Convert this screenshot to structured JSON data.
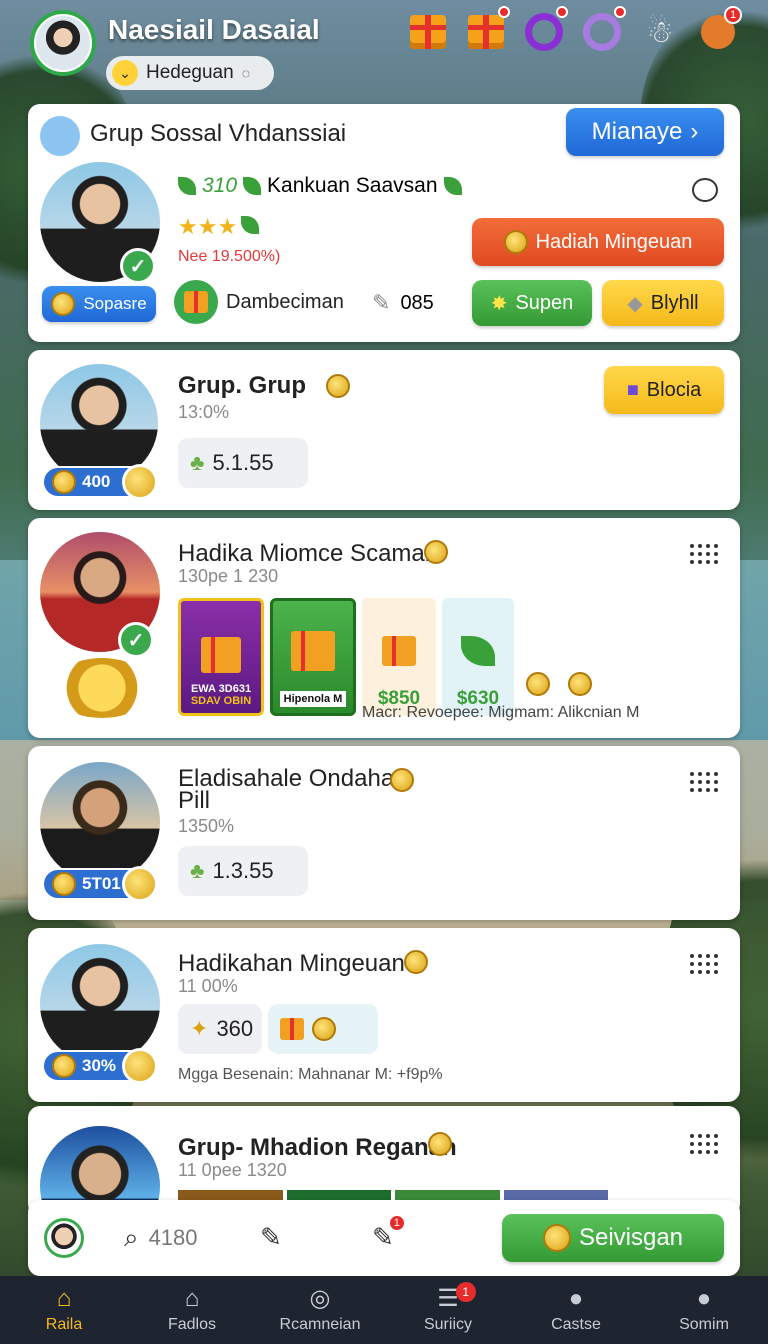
{
  "header": {
    "username": "Naesiail Dasaial",
    "status_label": "Hedeguan",
    "icons": [
      {
        "name": "gift-icon"
      },
      {
        "name": "gift-icon",
        "badge": ""
      },
      {
        "name": "ring-icon",
        "badge": ""
      },
      {
        "name": "ring-icon",
        "badge": ""
      },
      {
        "name": "mascot-icon",
        "badge": ""
      },
      {
        "name": "monkey-icon",
        "badge": "1"
      }
    ]
  },
  "featured": {
    "title": "Grup Sossal Vhdanssiai",
    "manage_label": "Mianaye",
    "rating_value": "310",
    "name": "Kankuan Saavsan",
    "stars_note": "Nee 19.500%)",
    "tag_label": "Sopasre",
    "action_label": "Dambeciman",
    "count_value": "085",
    "btn_primary": "Hadiah Mingeuan",
    "btn_support": "Supen",
    "btn_buy": "Blyhll"
  },
  "groups": [
    {
      "title": "Grup. Grup",
      "sub": "13:0%",
      "coins": "400",
      "stat": "5.1.55",
      "action": "Blocia"
    },
    {
      "title": "Hadika Miomce Scaman",
      "sub": "130pe 1 230",
      "tiles": [
        {
          "label": "SDAV OBIN",
          "sub": "EWA 3D631"
        },
        {
          "label": "Hipenola M"
        },
        {
          "price": "$850"
        },
        {
          "price": "$630"
        }
      ],
      "meta": "Macr: Revoepee: Migmam: Alikcnian M"
    },
    {
      "title": "Eladisahale Ondaha Pill",
      "sub": "1350%",
      "coins": "5T01",
      "stat": "1.3.55"
    },
    {
      "title": "Hadikahan Mingeuan",
      "sub": "11 00%",
      "coins": "30%",
      "stat": "360",
      "meta": "Mgga Besenain: Mahnanar M: +f9p%"
    },
    {
      "title": "Grup- Mhadion Reganan",
      "sub": "11 0pee 1320"
    }
  ],
  "action_bar": {
    "search_value": "4180",
    "cta_label": "Seivisgan",
    "badge": "1"
  },
  "nav": [
    {
      "label": "Raila",
      "icon": "home-icon",
      "active": true
    },
    {
      "label": "Fadlos",
      "icon": "house-outline-icon"
    },
    {
      "label": "Rcamneian",
      "icon": "target-icon"
    },
    {
      "label": "Suriicy",
      "icon": "list-icon",
      "badge": "1"
    },
    {
      "label": "Castse",
      "icon": "user-icon"
    },
    {
      "label": "Somim",
      "icon": "user-icon"
    }
  ],
  "colors": {
    "accent_green": "#3aa84c",
    "accent_blue": "#2068d6",
    "accent_orange": "#e04a20",
    "accent_yellow": "#f5b91a",
    "nav_bg": "#1f2530"
  }
}
